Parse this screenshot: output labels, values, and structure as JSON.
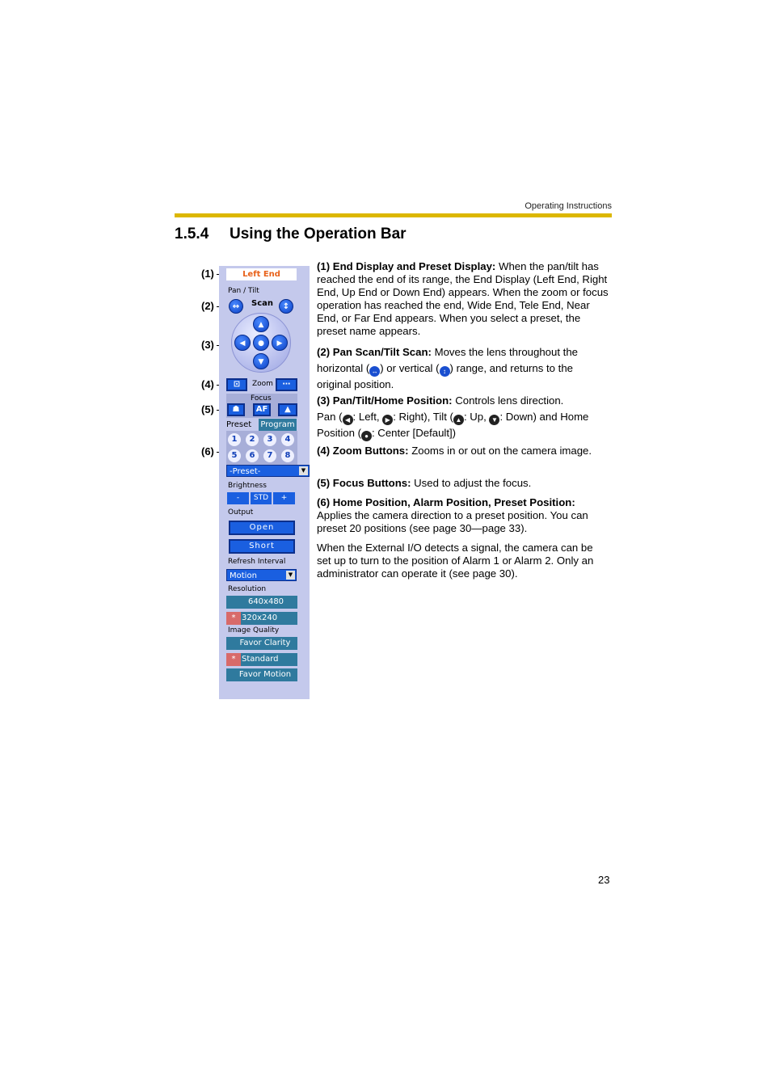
{
  "header": {
    "running_title": "Operating Instructions",
    "accent_color": "#dcb700"
  },
  "section": {
    "number": "1.5.4",
    "title": "Using the Operation Bar"
  },
  "callouts": [
    "(1)",
    "(2)",
    "(3)",
    "(4)",
    "(5)",
    "(6)"
  ],
  "operation_bar": {
    "end_display": "Left End",
    "pan_tilt_label": "Pan / Tilt",
    "scan_label": "Scan",
    "pan_scan_icon": "↔",
    "tilt_scan_icon": "↕",
    "dpad": {
      "up": "▲",
      "down": "▼",
      "left": "◀",
      "right": "▶",
      "home": "●"
    },
    "zoom_label": "Zoom",
    "zoom_wide_icon": "⊡",
    "zoom_tele_icon": "⋯",
    "focus_label": "Focus",
    "focus_near_icon": "☗",
    "focus_af_label": "AF",
    "focus_far_icon": "▲",
    "tab_preset": "Preset",
    "tab_program": "Program",
    "preset_numbers": [
      "1",
      "2",
      "3",
      "4",
      "5",
      "6",
      "7",
      "8"
    ],
    "preset_select": "-Preset-",
    "brightness_label": "Brightness",
    "brightness_buttons": [
      "-",
      "STD",
      "+"
    ],
    "output_label": "Output",
    "output_buttons": [
      "Open",
      "Short"
    ],
    "refresh_label": "Refresh Interval",
    "refresh_select": "Motion",
    "resolution_label": "Resolution",
    "resolution_options": [
      {
        "label": "640x480",
        "selected": false
      },
      {
        "label": "320x240",
        "selected": true
      }
    ],
    "quality_label": "Image Quality",
    "quality_options": [
      {
        "label": "Favor Clarity",
        "selected": false
      },
      {
        "label": "Standard",
        "selected": true
      },
      {
        "label": "Favor Motion",
        "selected": false
      }
    ],
    "selected_marker": "*"
  },
  "descriptions": {
    "d1_title": "(1) End Display and Preset Display:",
    "d1_body": " When the pan/tilt has reached the end of its range, the End Display (Left End, Right End, Up End or Down End) appears. When the zoom or focus operation has reached the end, Wide End, Tele End, Near End, or Far End appears. When you select a preset, the preset name appears.",
    "d2_title": "(2) Pan Scan/Tilt Scan:",
    "d2_a": " Moves the lens throughout the horizontal (",
    "d2_b": ") or vertical (",
    "d2_c": ") range, and returns to the original position.",
    "d3_title": "(3) Pan/Tilt/Home Position:",
    "d3_a": " Controls lens direction.",
    "d3_pan": "Pan (",
    "d3_left": ": Left, ",
    "d3_right": ": Right), Tilt (",
    "d3_up": ": Up, ",
    "d3_down": ": Down) and Home Position (",
    "d3_home": ": Center [Default])",
    "d4_title": "(4) Zoom Buttons:",
    "d4_body": " Zooms in or out on the camera image.",
    "d5_title": "(5) Focus Buttons:",
    "d5_body": " Used to adjust the focus.",
    "d6_title": "(6) Home Position, Alarm Position, Preset Position:",
    "d6_body": "Applies the camera direction to a preset position. You can preset 20 positions (see page 30—page 33).",
    "d7_body": "When the External I/O detects a signal, the camera can be set up to turn to the position of Alarm 1 or Alarm 2. Only an administrator can operate it (see page 30)."
  },
  "footer": {
    "page_number": "23"
  }
}
